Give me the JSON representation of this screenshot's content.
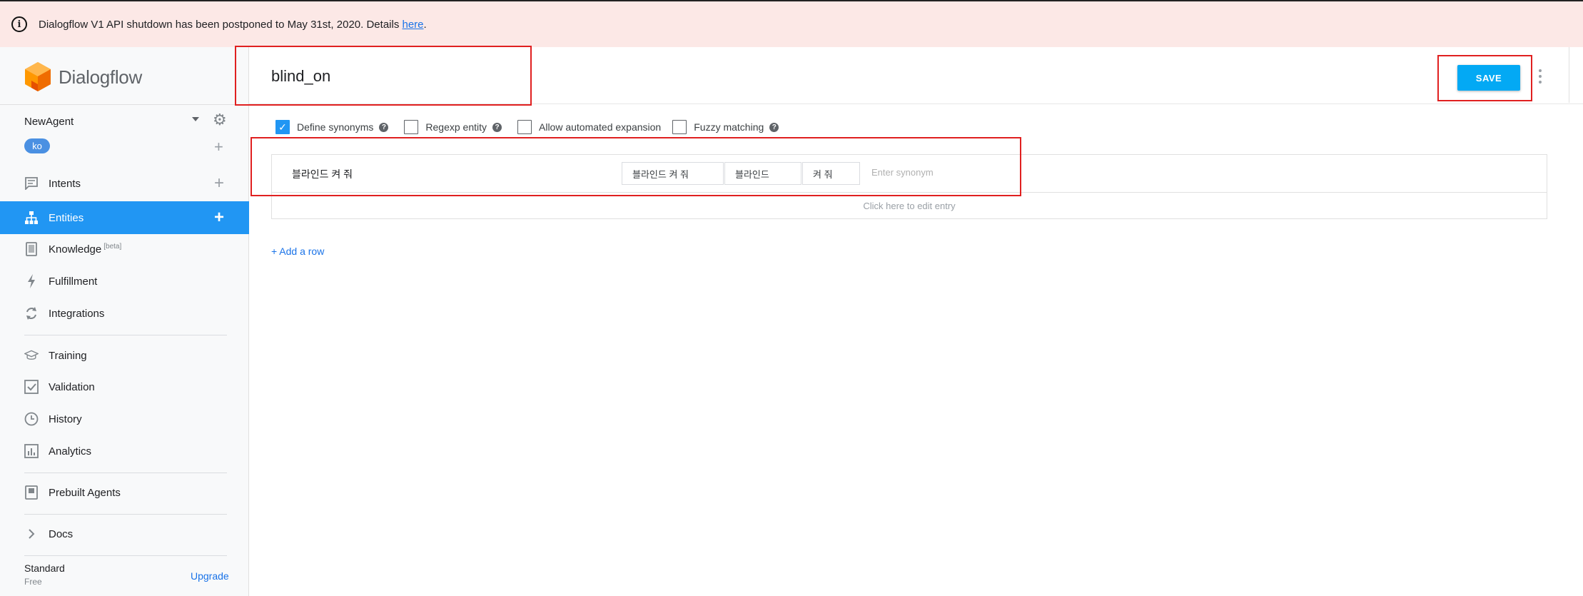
{
  "banner": {
    "text": "Dialogflow V1 API shutdown has been postponed to May 31st, 2020. Details ",
    "link": "here",
    "suffix": "."
  },
  "sidebar": {
    "logo_text": "Dialogflow",
    "agent_name": "NewAgent",
    "language": "ko",
    "items": [
      {
        "label": "Intents",
        "icon": "chat-icon"
      },
      {
        "label": "Entities",
        "icon": "entity-tree-icon"
      },
      {
        "label": "Knowledge",
        "badge": "[beta]",
        "icon": "book-icon"
      },
      {
        "label": "Fulfillment",
        "icon": "bolt-icon"
      },
      {
        "label": "Integrations",
        "icon": "sync-icon"
      },
      {
        "label": "Training",
        "icon": "graduation-cap-icon"
      },
      {
        "label": "Validation",
        "icon": "check-box-icon"
      },
      {
        "label": "History",
        "icon": "clock-icon"
      },
      {
        "label": "Analytics",
        "icon": "bar-chart-icon"
      },
      {
        "label": "Prebuilt Agents",
        "icon": "agent-book-icon"
      },
      {
        "label": "Docs",
        "icon": "chevron-right-icon"
      }
    ],
    "plan": "Standard",
    "plan_sub": "Free",
    "upgrade": "Upgrade"
  },
  "header": {
    "entity_name": "blind_on",
    "save_label": "SAVE"
  },
  "options": {
    "define_synonyms": "Define synonyms",
    "regexp_entity": "Regexp entity",
    "allow_expansion": "Allow automated expansion",
    "fuzzy_matching": "Fuzzy matching"
  },
  "entry": {
    "reference_value": "블라인드 켜 줘",
    "synonyms": [
      "블라인드 켜 줘",
      "블라인드",
      "켜 줘"
    ],
    "synonym_placeholder": "Enter synonym",
    "edit_hint": "Click here to edit entry"
  },
  "add_row": "+ Add a row",
  "colors": {
    "accent": "#2196f3",
    "save": "#03a9f4",
    "banner_bg": "#fce8e6",
    "highlight": "#e02020"
  }
}
